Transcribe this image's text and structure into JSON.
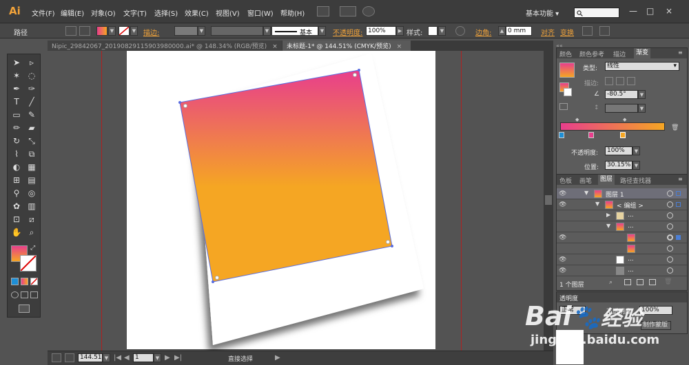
{
  "app": {
    "logo": "Ai",
    "workspace": "基本功能"
  },
  "menu": [
    "文件(F)",
    "编辑(E)",
    "对象(O)",
    "文字(T)",
    "选择(S)",
    "效果(C)",
    "视图(V)",
    "窗口(W)",
    "帮助(H)"
  ],
  "window_controls": {
    "minimize": "—",
    "maximize": "□",
    "close": "×"
  },
  "control_bar": {
    "selection_label": "路径",
    "stroke_label": "描边:",
    "stroke_style": "基本",
    "opacity_label": "不透明度:",
    "opacity_value": "100%",
    "style_label": "样式:",
    "corner_label": "边角:",
    "corner_value": "0 mm",
    "align_label": "对齐",
    "transform_label": "变换"
  },
  "tabs": [
    {
      "label": "Nipic_29842067_20190829115903980000.ai* @ 148.34% (RGB/预览)",
      "active": false
    },
    {
      "label": "未标题-1* @ 144.51% (CMYK/预览)",
      "active": true
    }
  ],
  "tools": [
    "selection-icon",
    "direct-selection-icon",
    "magic-wand-icon",
    "lasso-icon",
    "pen-icon",
    "curvature-icon",
    "type-icon",
    "line-icon",
    "rectangle-icon",
    "paintbrush-icon",
    "pencil-icon",
    "eraser-icon",
    "rotate-icon",
    "scale-icon",
    "width-icon",
    "free-transform-icon",
    "shape-builder-icon",
    "perspective-icon",
    "mesh-icon",
    "gradient-icon",
    "eyedropper-icon",
    "blend-icon",
    "symbol-sprayer-icon",
    "column-graph-icon",
    "artboard-icon",
    "slice-icon",
    "hand-icon",
    "zoom-icon"
  ],
  "gradient_panel": {
    "tabs": [
      "颜色",
      "颜色参考",
      "描边",
      "渐变"
    ],
    "type_label": "类型:",
    "type_value": "线性",
    "stroke_label": "描边:",
    "angle_value": "-80.5°",
    "opacity_label": "不透明度:",
    "opacity_value": "100%",
    "location_label": "位置:",
    "location_value": "30.15%",
    "gradient_start": "#e83e8c",
    "gradient_end": "#f5a623"
  },
  "layers_panel": {
    "tabs": [
      "色板",
      "画笔",
      "图层",
      "路径查找器"
    ],
    "rows": [
      {
        "name": "图层 1"
      },
      {
        "name": "< 编组 >"
      },
      {
        "name": "..."
      },
      {
        "name": "..."
      },
      {
        "name": ""
      },
      {
        "name": ""
      },
      {
        "name": "..."
      },
      {
        "name": "..."
      }
    ],
    "count_label": "1 个图层"
  },
  "transparency_panel": {
    "title": "透明度",
    "mode": "正常",
    "opacity_label": "不透明度",
    "opacity_value": "100%",
    "button": "制作蒙版"
  },
  "status": {
    "zoom": "144.51",
    "page": "1",
    "tool_name": "直接选择"
  },
  "watermark": {
    "brand": "Bai",
    "brand_cn": "经验",
    "url": "jingyan.baidu.com"
  }
}
